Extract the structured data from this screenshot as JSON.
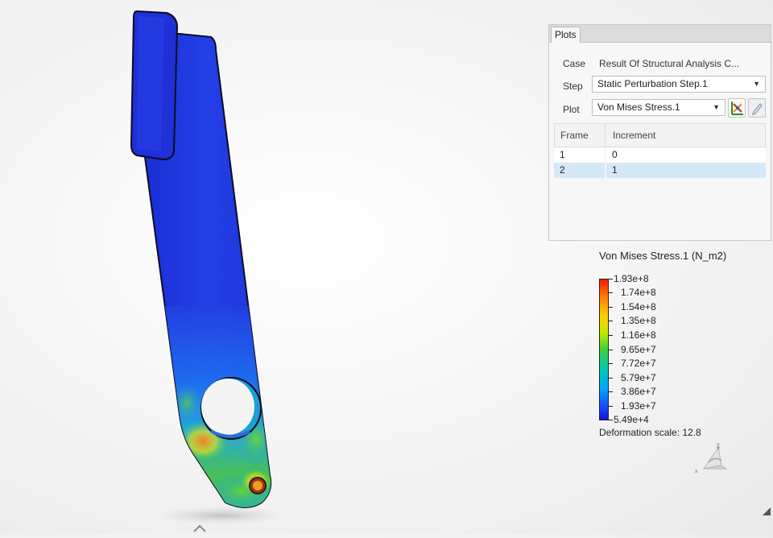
{
  "plots_panel": {
    "tab_label": "Plots",
    "case": {
      "label": "Case",
      "value": "Result Of Structural Analysis C..."
    },
    "step": {
      "label": "Step",
      "value": "Static Perturbation Step.1"
    },
    "plot": {
      "label": "Plot",
      "value": "Von Mises Stress.1"
    },
    "table": {
      "headers": [
        "Frame",
        "Increment"
      ],
      "rows": [
        {
          "frame": "1",
          "increment": "0"
        },
        {
          "frame": "2",
          "increment": "1"
        }
      ],
      "selected_row": 1
    },
    "icons": [
      "plot-settings-icon",
      "pencil-icon"
    ]
  },
  "legend": {
    "title": "Von Mises Stress.1 (N_m2)",
    "values": [
      "1.93e+8",
      "1.74e+8",
      "1.54e+8",
      "1.35e+8",
      "1.16e+8",
      "9.65e+7",
      "7.72e+7",
      "5.79e+7",
      "3.86e+7",
      "1.93e+7",
      "5.49e+4"
    ],
    "colors": {
      "max": "#ff1a00",
      "mid": "#3bd13b",
      "min": "#1414d8"
    }
  },
  "deformation_scale": "Deformation scale: 12.8",
  "triad_axis_labels": {
    "x": "x",
    "y": "y"
  }
}
